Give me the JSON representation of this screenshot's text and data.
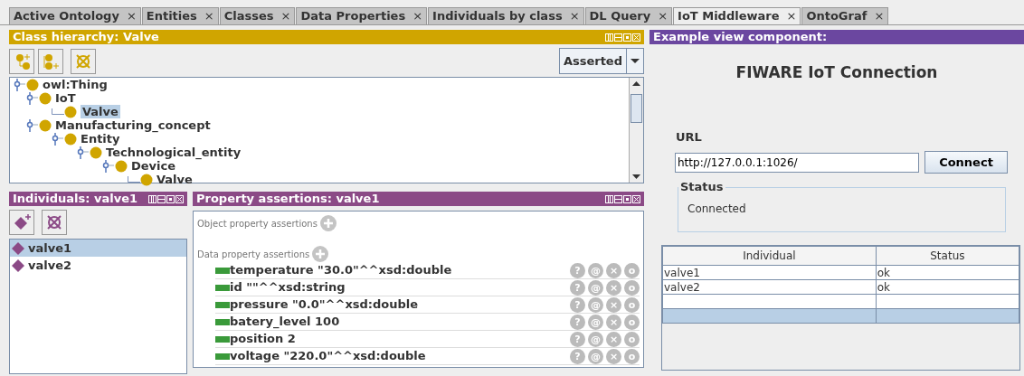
{
  "tabs": [
    {
      "label": "Active Ontology",
      "close": "×",
      "selected": false
    },
    {
      "label": "Entities",
      "close": "×",
      "selected": false
    },
    {
      "label": "Classes",
      "close": "×",
      "selected": false
    },
    {
      "label": "Data Properties",
      "close": "×",
      "selected": false
    },
    {
      "label": "Individuals by class",
      "close": "×",
      "selected": false
    },
    {
      "label": "DL Query",
      "close": "×",
      "selected": false
    },
    {
      "label": "IoT Middleware",
      "close": "×",
      "selected": true
    },
    {
      "label": "OntoGraf",
      "close": "×",
      "selected": false
    }
  ],
  "class_hierarchy": {
    "title": "Class hierarchy: Valve",
    "mode_dropdown": "Asserted",
    "tree": [
      {
        "label": "owl:Thing",
        "selected": false,
        "children": [
          {
            "label": "IoT",
            "selected": false,
            "children": [
              {
                "label": "Valve",
                "selected": true
              }
            ]
          },
          {
            "label": "Manufacturing_concept",
            "selected": false,
            "children": [
              {
                "label": "Entity",
                "selected": false,
                "children": [
                  {
                    "label": "Technological_entity",
                    "selected": false,
                    "children": [
                      {
                        "label": "Device",
                        "selected": false,
                        "children": [
                          {
                            "label": "Valve",
                            "selected": false
                          }
                        ]
                      }
                    ]
                  }
                ]
              }
            ]
          }
        ]
      }
    ]
  },
  "individuals": {
    "title": "Individuals: valve1",
    "items": [
      {
        "label": "valve1",
        "selected": true
      },
      {
        "label": "valve2",
        "selected": false
      }
    ]
  },
  "property_assertions": {
    "title": "Property assertions: valve1",
    "sections": [
      {
        "label": "Object property assertions"
      },
      {
        "label": "Data property assertions",
        "rows": [
          {
            "text": "temperature  \"30.0\"^^xsd:double",
            "buttons": [
              "?",
              "@",
              "×",
              "o"
            ]
          },
          {
            "text": "id  \"\"^^xsd:string",
            "buttons": [
              "?",
              "@",
              "×",
              "o"
            ]
          },
          {
            "text": "pressure  \"0.0\"^^xsd:double",
            "buttons": [
              "?",
              "@",
              "×",
              "o"
            ]
          },
          {
            "text": "batery_level  100",
            "buttons": [
              "?",
              "@",
              "×",
              "o"
            ]
          },
          {
            "text": "position  2",
            "buttons": [
              "?",
              "@",
              "×",
              "o"
            ]
          },
          {
            "text": "voltage  \"220.0\"^^xsd:double",
            "buttons": [
              "?",
              "@",
              "×",
              "o"
            ]
          }
        ]
      }
    ]
  },
  "example_view": {
    "title": "Example view component:",
    "heading": "FIWARE IoT Connection",
    "url_label": "URL",
    "url_value": "http://127.0.0.1:1026/",
    "connect_button": "Connect",
    "status": {
      "legend": "Status",
      "text": "Connected"
    },
    "table": {
      "columns": [
        "Individual",
        "Status"
      ],
      "rows": [
        {
          "cells": [
            "valve1",
            "ok"
          ],
          "selected": false
        },
        {
          "cells": [
            "valve2",
            "ok"
          ],
          "selected": false
        },
        {
          "selected": false
        },
        {
          "selected": true
        }
      ]
    }
  }
}
